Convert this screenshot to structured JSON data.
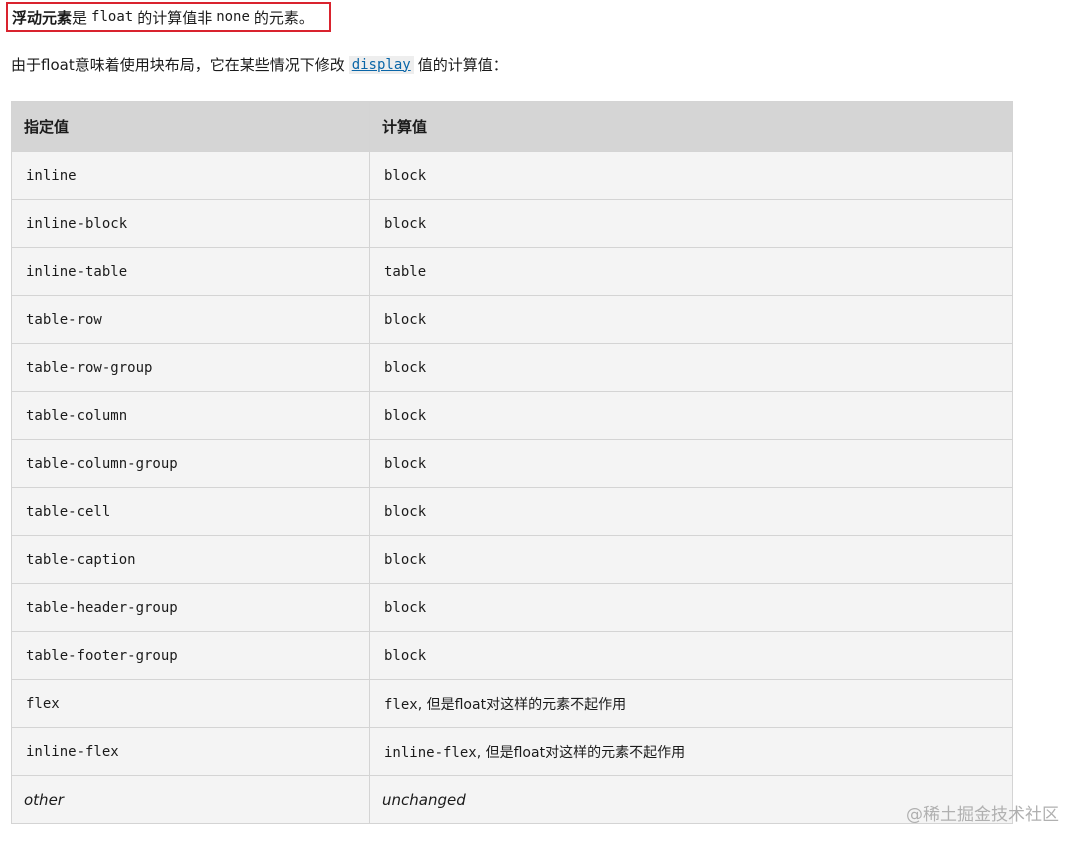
{
  "definition": {
    "term": "浮动元素",
    "text_1": "是",
    "code_1": "float",
    "text_2": "的计算值非",
    "code_2": "none",
    "text_3": "的元素。"
  },
  "intro": {
    "text_before": "由于float意味着使用块布局，它在某些情况下修改",
    "link": "display",
    "text_after": "值的计算值："
  },
  "table": {
    "headers": [
      "指定值",
      "计算值"
    ],
    "rows": [
      {
        "specified": "inline",
        "computed": "block",
        "note": ""
      },
      {
        "specified": "inline-block",
        "computed": "block",
        "note": ""
      },
      {
        "specified": "inline-table",
        "computed": "table",
        "note": ""
      },
      {
        "specified": "table-row",
        "computed": "block",
        "note": ""
      },
      {
        "specified": "table-row-group",
        "computed": "block",
        "note": ""
      },
      {
        "specified": "table-column",
        "computed": "block",
        "note": ""
      },
      {
        "specified": "table-column-group",
        "computed": "block",
        "note": ""
      },
      {
        "specified": "table-cell",
        "computed": "block",
        "note": ""
      },
      {
        "specified": "table-caption",
        "computed": "block",
        "note": ""
      },
      {
        "specified": "table-header-group",
        "computed": "block",
        "note": ""
      },
      {
        "specified": "table-footer-group",
        "computed": "block",
        "note": ""
      },
      {
        "specified": "flex",
        "computed": "flex",
        "note": ", 但是float对这样的元素不起作用"
      },
      {
        "specified": "inline-flex",
        "computed": "inline-flex",
        "note": ", 但是float对这样的元素不起作用"
      }
    ],
    "last_row": {
      "specified": "other",
      "computed": "unchanged"
    }
  },
  "watermark": "@稀土掘金技术社区"
}
